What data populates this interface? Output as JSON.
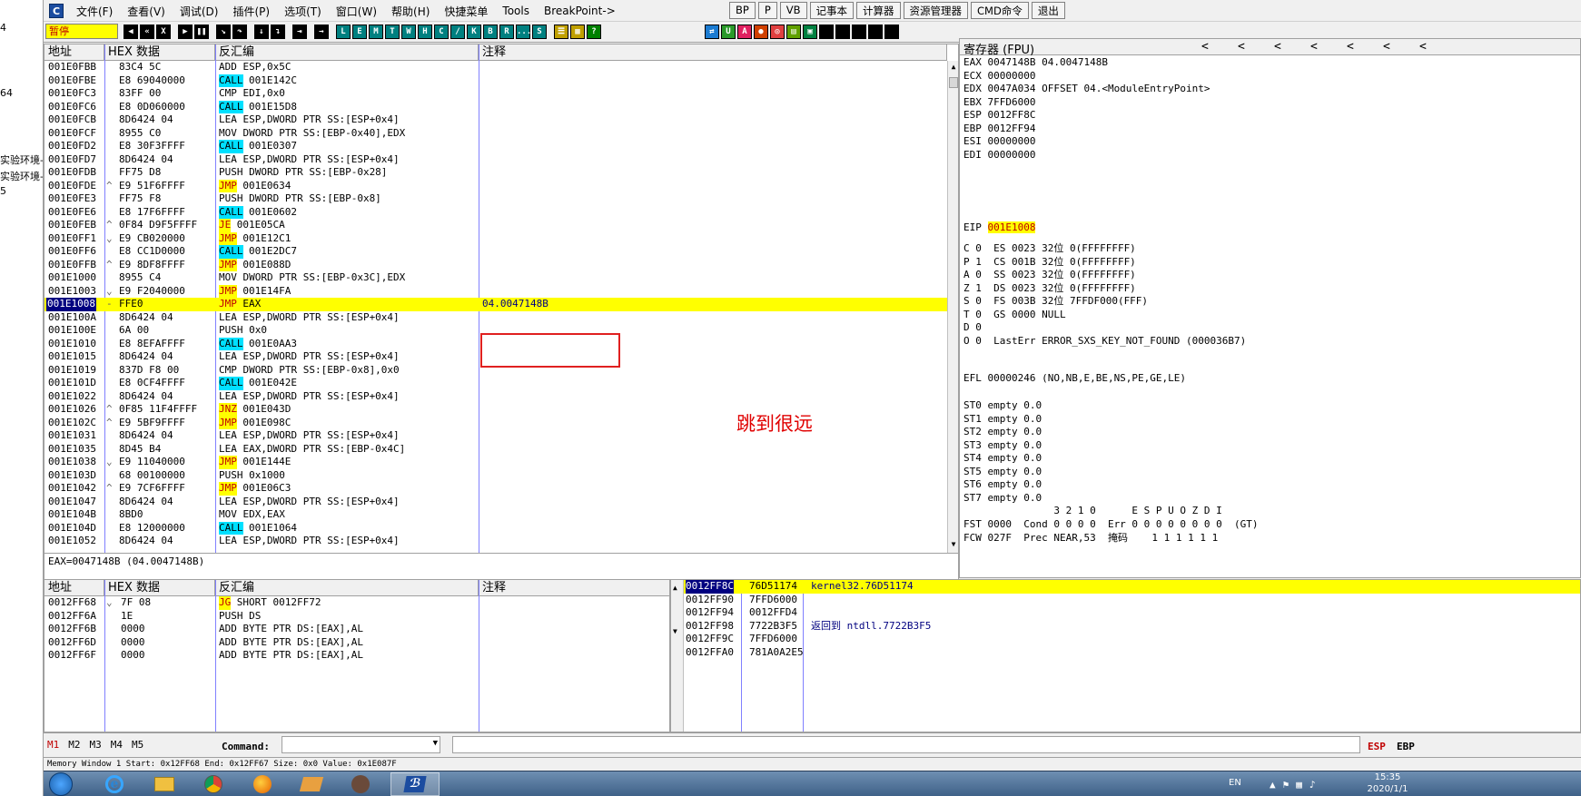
{
  "left_strip": [
    "4",
    "64",
    "实验环境-",
    "实验环境-",
    "5"
  ],
  "menu": [
    "文件(F)",
    "查看(V)",
    "调试(D)",
    "插件(P)",
    "选项(T)",
    "窗口(W)",
    "帮助(H)",
    "快捷菜单",
    "Tools",
    "BreakPoint->"
  ],
  "right_buttons": [
    "BP",
    "P",
    "VB",
    "记事本",
    "计算器",
    "资源管理器",
    "CMD命令",
    "退出"
  ],
  "toolbar_status": "暂停",
  "toolbar_letters": [
    "L",
    "E",
    "M",
    "T",
    "W",
    "H",
    "C",
    "/",
    "K",
    "B",
    "R",
    "...",
    "S"
  ],
  "disasm_headers": [
    "地址",
    "HEX 数据",
    "反汇编",
    "注释"
  ],
  "disasm_rows": [
    {
      "addr": "001E0FBB",
      "mark": "",
      "hex": "83C4 5C",
      "asm": "ADD ESP,0x5C",
      "hl": "",
      "op": "",
      "rest": ""
    },
    {
      "addr": "001E0FBE",
      "mark": "",
      "hex": "E8 69040000",
      "asm": "",
      "hl": "call",
      "op": "CALL",
      "rest": " 001E142C"
    },
    {
      "addr": "001E0FC3",
      "mark": "",
      "hex": "83FF 00",
      "asm": "CMP EDI,0x0",
      "hl": "",
      "op": "",
      "rest": ""
    },
    {
      "addr": "001E0FC6",
      "mark": "",
      "hex": "E8 0D060000",
      "asm": "",
      "hl": "call",
      "op": "CALL",
      "rest": " 001E15D8"
    },
    {
      "addr": "001E0FCB",
      "mark": "",
      "hex": "8D6424 04",
      "asm": "LEA ESP,DWORD PTR SS:[ESP+0x4]",
      "hl": "",
      "op": "",
      "rest": ""
    },
    {
      "addr": "001E0FCF",
      "mark": "",
      "hex": "8955 C0",
      "asm": "MOV DWORD PTR SS:[EBP-0x40],EDX",
      "hl": "",
      "op": "",
      "rest": ""
    },
    {
      "addr": "001E0FD2",
      "mark": "",
      "hex": "E8 30F3FFFF",
      "asm": "",
      "hl": "call",
      "op": "CALL",
      "rest": " 001E0307"
    },
    {
      "addr": "001E0FD7",
      "mark": "",
      "hex": "8D6424 04",
      "asm": "LEA ESP,DWORD PTR SS:[ESP+0x4]",
      "hl": "",
      "op": "",
      "rest": ""
    },
    {
      "addr": "001E0FDB",
      "mark": "",
      "hex": "FF75 D8",
      "asm": "PUSH DWORD PTR SS:[EBP-0x28]",
      "hl": "",
      "op": "",
      "rest": ""
    },
    {
      "addr": "001E0FDE",
      "mark": "^",
      "hex": "E9 51F6FFFF",
      "asm": "",
      "hl": "jmp",
      "op": "JMP",
      "rest": " 001E0634"
    },
    {
      "addr": "001E0FE3",
      "mark": "",
      "hex": "FF75 F8",
      "asm": "PUSH DWORD PTR SS:[EBP-0x8]",
      "hl": "",
      "op": "",
      "rest": ""
    },
    {
      "addr": "001E0FE6",
      "mark": "",
      "hex": "E8 17F6FFFF",
      "asm": "",
      "hl": "call",
      "op": "CALL",
      "rest": " 001E0602"
    },
    {
      "addr": "001E0FEB",
      "mark": "^",
      "hex": "0F84 D9F5FFFF",
      "asm": "",
      "hl": "jmp",
      "op": "JE",
      "rest": " 001E05CA"
    },
    {
      "addr": "001E0FF1",
      "mark": "⌄",
      "hex": "E9 CB020000",
      "asm": "",
      "hl": "jmp",
      "op": "JMP",
      "rest": " 001E12C1"
    },
    {
      "addr": "001E0FF6",
      "mark": "",
      "hex": "E8 CC1D0000",
      "asm": "",
      "hl": "call",
      "op": "CALL",
      "rest": " 001E2DC7"
    },
    {
      "addr": "001E0FFB",
      "mark": "^",
      "hex": "E9 8DF8FFFF",
      "asm": "",
      "hl": "jmp",
      "op": "JMP",
      "rest": " 001E088D"
    },
    {
      "addr": "001E1000",
      "mark": "",
      "hex": "8955 C4",
      "asm": "MOV DWORD PTR SS:[EBP-0x3C],EDX",
      "hl": "",
      "op": "",
      "rest": ""
    },
    {
      "addr": "001E1003",
      "mark": "⌄",
      "hex": "E9 F2040000",
      "asm": "",
      "hl": "jmp",
      "op": "JMP",
      "rest": " 001E14FA"
    },
    {
      "addr": "001E1008",
      "mark": "-",
      "hex": "FFE0",
      "asm": "",
      "hl": "jmp",
      "op": "JMP",
      "rest": " EAX",
      "sel": true
    },
    {
      "addr": "001E100A",
      "mark": "",
      "hex": "8D6424 04",
      "asm": "LEA ESP,DWORD PTR SS:[ESP+0x4]",
      "hl": "",
      "op": "",
      "rest": ""
    },
    {
      "addr": "001E100E",
      "mark": "",
      "hex": "6A 00",
      "asm": "PUSH 0x0",
      "hl": "",
      "op": "",
      "rest": ""
    },
    {
      "addr": "001E1010",
      "mark": "",
      "hex": "E8 8EFAFFFF",
      "asm": "",
      "hl": "call",
      "op": "CALL",
      "rest": " 001E0AA3"
    },
    {
      "addr": "001E1015",
      "mark": "",
      "hex": "8D6424 04",
      "asm": "LEA ESP,DWORD PTR SS:[ESP+0x4]",
      "hl": "",
      "op": "",
      "rest": ""
    },
    {
      "addr": "001E1019",
      "mark": "",
      "hex": "837D F8 00",
      "asm": "CMP DWORD PTR SS:[EBP-0x8],0x0",
      "hl": "",
      "op": "",
      "rest": ""
    },
    {
      "addr": "001E101D",
      "mark": "",
      "hex": "E8 0CF4FFFF",
      "asm": "",
      "hl": "call",
      "op": "CALL",
      "rest": " 001E042E"
    },
    {
      "addr": "001E1022",
      "mark": "",
      "hex": "8D6424 04",
      "asm": "LEA ESP,DWORD PTR SS:[ESP+0x4]",
      "hl": "",
      "op": "",
      "rest": ""
    },
    {
      "addr": "001E1026",
      "mark": "^",
      "hex": "0F85 11F4FFFF",
      "asm": "",
      "hl": "jmp",
      "op": "JNZ",
      "rest": " 001E043D"
    },
    {
      "addr": "001E102C",
      "mark": "^",
      "hex": "E9 5BF9FFFF",
      "asm": "",
      "hl": "jmp",
      "op": "JMP",
      "rest": " 001E098C"
    },
    {
      "addr": "001E1031",
      "mark": "",
      "hex": "8D6424 04",
      "asm": "LEA ESP,DWORD PTR SS:[ESP+0x4]",
      "hl": "",
      "op": "",
      "rest": ""
    },
    {
      "addr": "001E1035",
      "mark": "",
      "hex": "8D45 B4",
      "asm": "LEA EAX,DWORD PTR SS:[EBP-0x4C]",
      "hl": "",
      "op": "",
      "rest": ""
    },
    {
      "addr": "001E1038",
      "mark": "⌄",
      "hex": "E9 11040000",
      "asm": "",
      "hl": "jmp",
      "op": "JMP",
      "rest": " 001E144E"
    },
    {
      "addr": "001E103D",
      "mark": "",
      "hex": "68 00100000",
      "asm": "PUSH 0x1000",
      "hl": "",
      "op": "",
      "rest": ""
    },
    {
      "addr": "001E1042",
      "mark": "^",
      "hex": "E9 7CF6FFFF",
      "asm": "",
      "hl": "jmp",
      "op": "JMP",
      "rest": " 001E06C3"
    },
    {
      "addr": "001E1047",
      "mark": "",
      "hex": "8D6424 04",
      "asm": "LEA ESP,DWORD PTR SS:[ESP+0x4]",
      "hl": "",
      "op": "",
      "rest": ""
    },
    {
      "addr": "001E104B",
      "mark": "",
      "hex": "8BD0",
      "asm": "MOV EDX,EAX",
      "hl": "",
      "op": "",
      "rest": ""
    },
    {
      "addr": "001E104D",
      "mark": "",
      "hex": "E8 12000000",
      "asm": "",
      "hl": "call",
      "op": "CALL",
      "rest": " 001E1064"
    },
    {
      "addr": "001E1052",
      "mark": "",
      "hex": "8D6424 04",
      "asm": "LEA ESP,DWORD PTR SS:[ESP+0x4]",
      "hl": "",
      "op": "",
      "rest": ""
    }
  ],
  "selected_comment": "04.0047148B",
  "annotation_text": "跳到很远",
  "info_line": "EAX=0047148B (04.0047148B)",
  "registers_title": "寄存器 (FPU)",
  "reg_arrows": [
    "<",
    "<",
    "<",
    "<",
    "<",
    "<",
    "<"
  ],
  "registers_gp": [
    "EAX 0047148B 04.0047148B",
    "ECX 00000000",
    "EDX 0047A034 OFFSET 04.<ModuleEntryPoint>",
    "EBX 7FFD6000",
    "ESP 0012FF8C",
    "EBP 0012FF94",
    "ESI 00000000",
    "EDI 00000000"
  ],
  "eip_label": "EIP",
  "eip_value": "001E1008",
  "flags": [
    "C 0  ES 0023 32位 0(FFFFFFFF)",
    "P 1  CS 001B 32位 0(FFFFFFFF)",
    "A 0  SS 0023 32位 0(FFFFFFFF)",
    "Z 1  DS 0023 32位 0(FFFFFFFF)",
    "S 0  FS 003B 32位 7FFDF000(FFF)",
    "T 0  GS 0000 NULL",
    "D 0",
    "O 0  LastErr ERROR_SXS_KEY_NOT_FOUND (000036B7)"
  ],
  "efl": "EFL 00000246 (NO,NB,E,BE,NS,PE,GE,LE)",
  "fpu": [
    "ST0 empty 0.0",
    "ST1 empty 0.0",
    "ST2 empty 0.0",
    "ST3 empty 0.0",
    "ST4 empty 0.0",
    "ST5 empty 0.0",
    "ST6 empty 0.0",
    "ST7 empty 0.0"
  ],
  "fpu_bits_header": "               3 2 1 0      E S P U O Z D I",
  "fst": "FST 0000  Cond 0 0 0 0  Err 0 0 0 0 0 0 0 0  (GT)",
  "fcw": "FCW 027F  Prec NEAR,53  掩码    1 1 1 1 1 1",
  "dump_headers": [
    "地址",
    "HEX 数据",
    "反汇编",
    "注释"
  ],
  "dump_rows": [
    {
      "addr": "0012FF68",
      "mark": "⌄",
      "hex": "7F 08",
      "op": "JG",
      "rest": " SHORT 0012FF72",
      "hl": "jmp"
    },
    {
      "addr": "0012FF6A",
      "mark": "",
      "hex": "1E",
      "op": "",
      "rest": "PUSH DS",
      "hl": ""
    },
    {
      "addr": "0012FF6B",
      "mark": "",
      "hex": "0000",
      "op": "",
      "rest": "ADD BYTE PTR DS:[EAX],AL",
      "hl": ""
    },
    {
      "addr": "0012FF6D",
      "mark": "",
      "hex": "0000",
      "op": "",
      "rest": "ADD BYTE PTR DS:[EAX],AL",
      "hl": ""
    },
    {
      "addr": "0012FF6F",
      "mark": "",
      "hex": "0000",
      "op": "",
      "rest": "ADD BYTE PTR DS:[EAX],AL",
      "hl": ""
    }
  ],
  "stack_rows": [
    {
      "addr": "0012FF8C",
      "val": "76D51174",
      "comment": "kernel32.76D51174",
      "sel": true
    },
    {
      "addr": "0012FF90",
      "val": "7FFD6000",
      "comment": ""
    },
    {
      "addr": "0012FF94",
      "val": "0012FFD4",
      "comment": ""
    },
    {
      "addr": "0012FF98",
      "val": "7722B3F5",
      "comment": "返回到 ntdll.7722B3F5"
    },
    {
      "addr": "0012FF9C",
      "val": "7FFD6000",
      "comment": ""
    },
    {
      "addr": "0012FFA0",
      "val": "781A0A2E5",
      "comment": ""
    }
  ],
  "mem_tabs": [
    "M1",
    "M2",
    "M3",
    "M4",
    "M5"
  ],
  "command_label": "Command:",
  "esp_label": "ESP",
  "ebp_label": "EBP",
  "status_text": "Memory Window 1  Start: 0x12FF68  End: 0x12FF67  Size: 0x0 Value: 0x1E087F",
  "clock_time": "15:35",
  "clock_date": "2020/1/1",
  "tray_lang": "EN",
  "colors": {
    "call": "#00e0ff",
    "jmp": "#ffff00",
    "jmp_text": "#c00000",
    "selected_row": "#ffff00",
    "address_selected": "#000080",
    "annotation": "#e00000"
  }
}
